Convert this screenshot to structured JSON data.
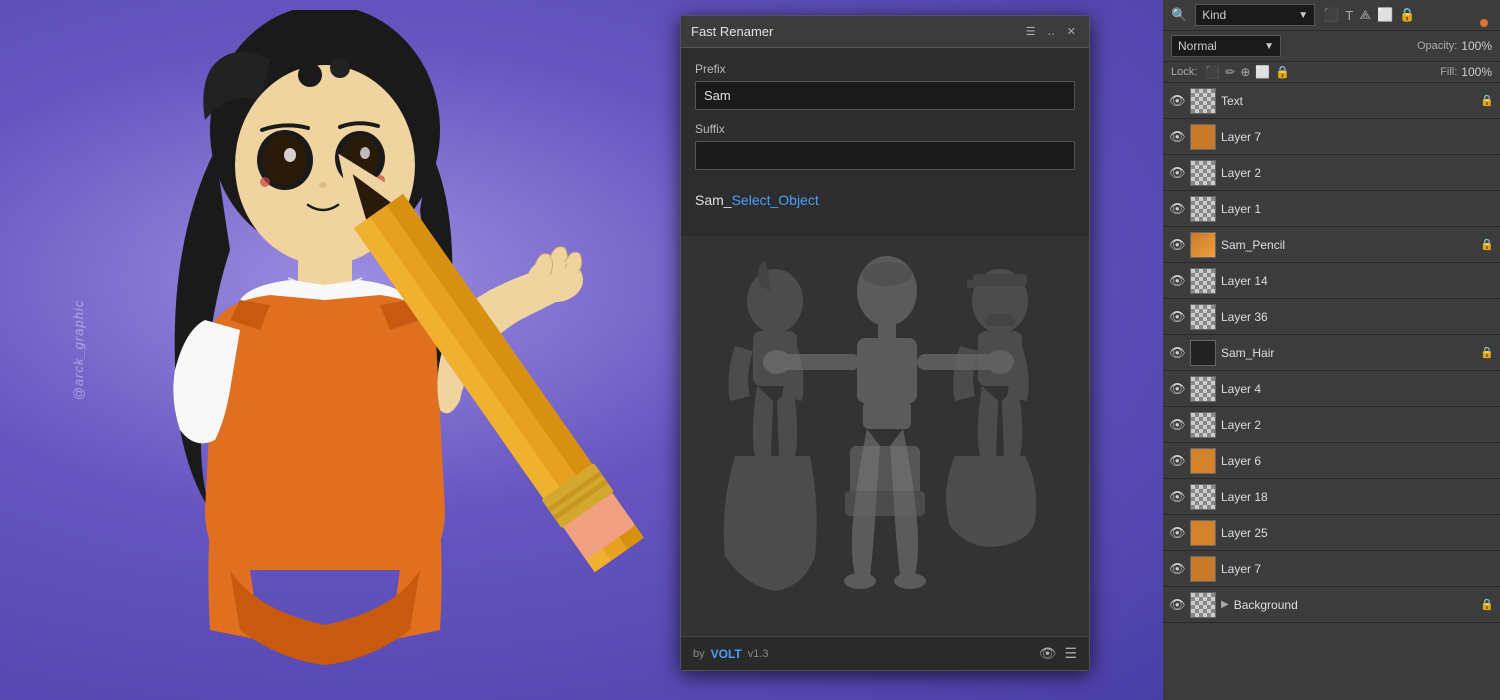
{
  "canvas": {
    "watermark": "@arck_graphic"
  },
  "dialog": {
    "title": "Fast Renamer",
    "minimize_label": "‥",
    "close_label": "✕",
    "menu_label": "☰",
    "prefix_label": "Prefix",
    "prefix_value": "Sam",
    "suffix_label": "Suffix",
    "suffix_value": "",
    "preview_static": "Sam_",
    "preview_dynamic": "Select_Object",
    "footer_by": "by",
    "footer_brand": "VOLT",
    "footer_version": "v1.3"
  },
  "layers_panel": {
    "kind_label": "Kind",
    "blend_mode": "Normal",
    "opacity_label": "Opacity:",
    "opacity_value": "100%",
    "fill_label": "Fill:",
    "fill_value": "100%",
    "lock_label": "Lock:",
    "circle_color": "#e07030",
    "layers": [
      {
        "id": 1,
        "name": "Text",
        "thumb": "checker",
        "locked": true,
        "visible": true,
        "active": false
      },
      {
        "id": 2,
        "name": "Layer 7",
        "thumb": "orange",
        "locked": false,
        "visible": true,
        "active": false
      },
      {
        "id": 3,
        "name": "Layer 2",
        "thumb": "checker",
        "locked": false,
        "visible": true,
        "active": false
      },
      {
        "id": 4,
        "name": "Layer 1",
        "thumb": "checker",
        "locked": false,
        "visible": true,
        "active": false
      },
      {
        "id": 5,
        "name": "Sam_Pencil",
        "thumb": "pencil",
        "locked": true,
        "visible": true,
        "active": false
      },
      {
        "id": 6,
        "name": "Layer 14",
        "thumb": "checker",
        "locked": false,
        "visible": true,
        "active": false
      },
      {
        "id": 7,
        "name": "Layer 36",
        "thumb": "checker",
        "locked": false,
        "visible": true,
        "active": false
      },
      {
        "id": 8,
        "name": "Sam_Hair",
        "thumb": "hair",
        "locked": true,
        "visible": true,
        "active": false
      },
      {
        "id": 9,
        "name": "Layer 4",
        "thumb": "checker",
        "locked": false,
        "visible": true,
        "active": false
      },
      {
        "id": 10,
        "name": "Layer 2",
        "thumb": "checker",
        "locked": false,
        "visible": true,
        "active": false
      },
      {
        "id": 11,
        "name": "Layer 6",
        "thumb": "orange-small",
        "locked": false,
        "visible": true,
        "active": false
      },
      {
        "id": 12,
        "name": "Layer 18",
        "thumb": "checker",
        "locked": false,
        "visible": true,
        "active": false
      },
      {
        "id": 13,
        "name": "Layer 25",
        "thumb": "orange-small",
        "locked": false,
        "visible": true,
        "active": false
      },
      {
        "id": 14,
        "name": "Layer 7",
        "thumb": "orange",
        "locked": false,
        "visible": true,
        "active": false
      },
      {
        "id": 15,
        "name": "Background",
        "thumb": "checker",
        "locked": true,
        "visible": true,
        "active": false,
        "is_bg": true
      }
    ]
  }
}
